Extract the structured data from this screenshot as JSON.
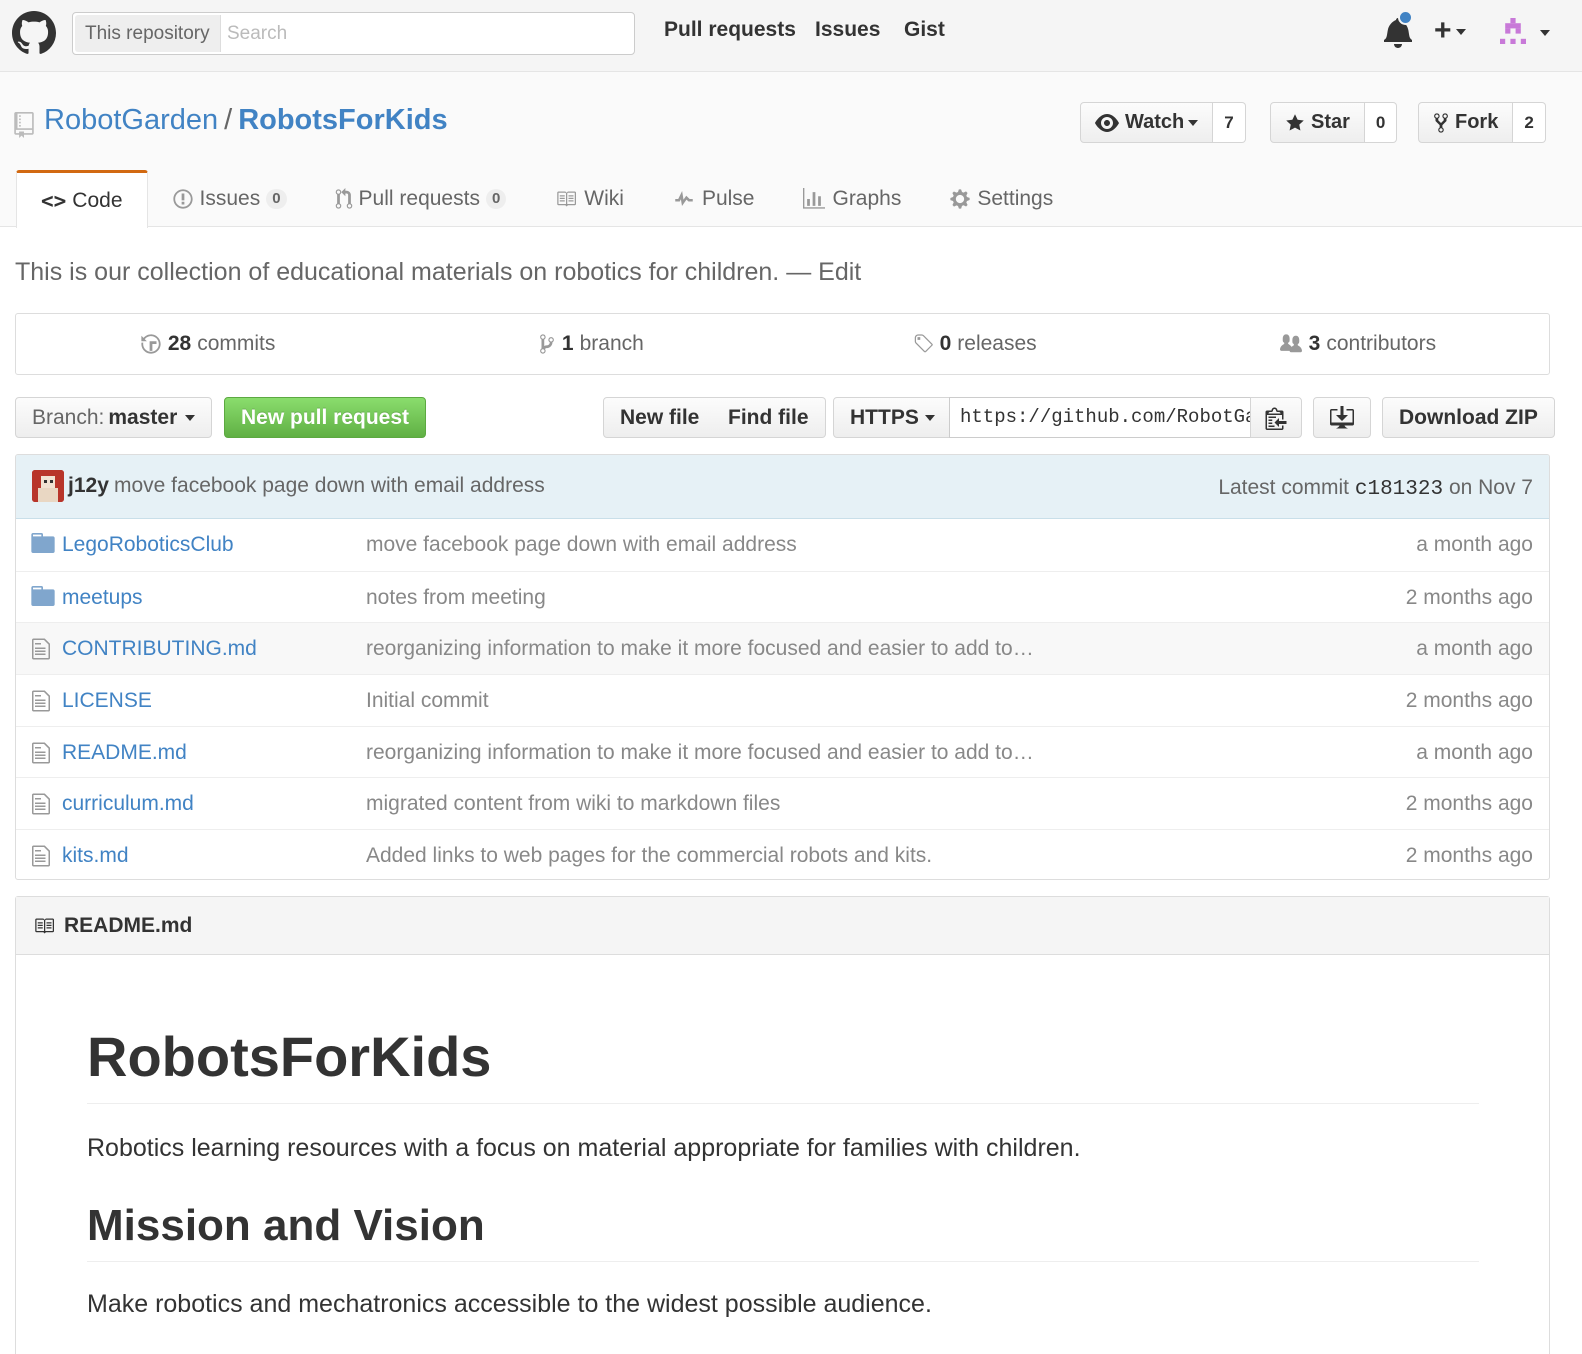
{
  "header": {
    "search_scope": "This repository",
    "search_placeholder": "Search",
    "nav": [
      "Pull requests",
      "Issues",
      "Gist"
    ]
  },
  "repo": {
    "owner": "RobotGarden",
    "separator": "/",
    "name": "RobotsForKids",
    "watch_label": "Watch",
    "watch_count": "7",
    "star_label": "Star",
    "star_count": "0",
    "fork_label": "Fork",
    "fork_count": "2"
  },
  "tabs": [
    {
      "label": "Code"
    },
    {
      "label": "Issues",
      "count": "0"
    },
    {
      "label": "Pull requests",
      "count": "0"
    },
    {
      "label": "Wiki"
    },
    {
      "label": "Pulse"
    },
    {
      "label": "Graphs"
    },
    {
      "label": "Settings"
    }
  ],
  "description": {
    "text": "This is our collection of educational materials on robotics for children.",
    "edit_link": "— Edit"
  },
  "summary": {
    "commits_num": "28",
    "commits_label": "commits",
    "branch_num": "1",
    "branch_label": "branch",
    "releases_num": "0",
    "releases_label": "releases",
    "contributors_num": "3",
    "contributors_label": "contributors"
  },
  "filenav": {
    "branch_prefix": "Branch:",
    "branch_name": "master",
    "new_pr": "New pull request",
    "new_file": "New file",
    "find_file": "Find file",
    "protocol": "HTTPS",
    "clone_url": "https://github.com/RobotGarden/RobotsForKids.git",
    "download_zip": "Download ZIP"
  },
  "latest_commit": {
    "author": "j12y",
    "message": "move facebook page down with email address",
    "prefix": "Latest commit",
    "sha": "c181323",
    "date": "on Nov 7"
  },
  "files": [
    {
      "type": "dir",
      "name": "LegoRoboticsClub",
      "message": "move facebook page down with email address",
      "age": "a month ago"
    },
    {
      "type": "dir",
      "name": "meetups",
      "message": "notes from meeting",
      "age": "2 months ago"
    },
    {
      "type": "file",
      "name": "CONTRIBUTING.md",
      "message": "reorganizing information to make it more focused and easier to add to…",
      "age": "a month ago"
    },
    {
      "type": "file",
      "name": "LICENSE",
      "message": "Initial commit",
      "age": "2 months ago"
    },
    {
      "type": "file",
      "name": "README.md",
      "message": "reorganizing information to make it more focused and easier to add to…",
      "age": "a month ago"
    },
    {
      "type": "file",
      "name": "curriculum.md",
      "message": "migrated content from wiki to markdown files",
      "age": "2 months ago"
    },
    {
      "type": "file",
      "name": "kits.md",
      "message": "Added links to web pages for the commercial robots and kits.",
      "age": "2 months ago"
    }
  ],
  "readme": {
    "filename": "README.md",
    "h1": "RobotsForKids",
    "intro": "Robotics learning resources with a focus on material appropriate for families with children.",
    "h2": "Mission and Vision",
    "mission": "Make robotics and mechatronics accessible to the widest possible audience."
  },
  "colors": {
    "link": "#4183c4",
    "green_button": "#60b044",
    "tab_accent": "#d26911",
    "commit_tease_bg": "#e6f1f6"
  }
}
